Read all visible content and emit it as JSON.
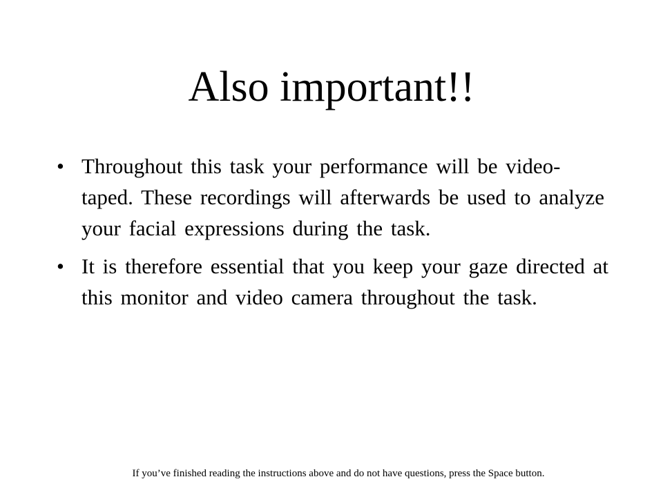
{
  "slide": {
    "title": "Also important!!",
    "bullet_symbol": "•",
    "bullets": [
      "Throughout this task your performance will be video-taped. These recordings will afterwards be used to analyze your facial expressions during the task.",
      "It is therefore essential that you keep your gaze directed at this monitor and video camera throughout the task."
    ],
    "footer": "If you’ve finished reading the instructions above and do not have questions, press the Space button."
  }
}
